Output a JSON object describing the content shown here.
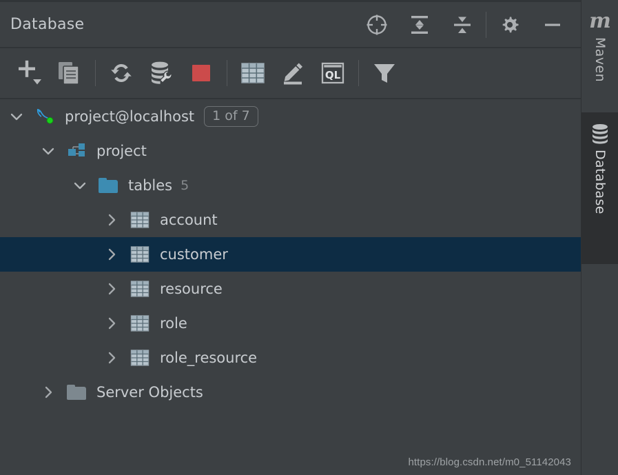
{
  "header": {
    "title": "Database",
    "actions": [
      {
        "name": "scroll-from-source-button",
        "icon": "crosshair-icon"
      },
      {
        "name": "expand-all-button",
        "icon": "expand-all-icon"
      },
      {
        "name": "collapse-all-button",
        "icon": "collapse-all-icon"
      },
      {
        "name": "settings-button",
        "icon": "gear-icon"
      },
      {
        "name": "hide-button",
        "icon": "minimize-icon"
      }
    ]
  },
  "toolbar": {
    "buttons": [
      {
        "name": "add-button",
        "icon": "plus-dropdown-icon"
      },
      {
        "name": "duplicate-button",
        "icon": "copy-icon"
      },
      {
        "name": "refresh-button",
        "icon": "refresh-icon"
      },
      {
        "name": "data-source-properties-button",
        "icon": "database-wrench-icon"
      },
      {
        "name": "stop-button",
        "icon": "stop-square-icon"
      },
      {
        "name": "jump-to-table-button",
        "icon": "table-grid-icon"
      },
      {
        "name": "edit-button",
        "icon": "pencil-icon"
      },
      {
        "name": "open-console-button",
        "icon": "ql-console-icon"
      },
      {
        "name": "filter-button",
        "icon": "funnel-icon"
      }
    ],
    "ql_label": "QL"
  },
  "tree": {
    "nodes": [
      {
        "label": "project@localhost",
        "icon": "mysql-dolphin-icon",
        "status": "connected",
        "badge": "1 of 7",
        "expanded": true,
        "selected": false,
        "indent": 0
      },
      {
        "label": "project",
        "icon": "schema-icon",
        "expanded": true,
        "selected": false,
        "indent": 1
      },
      {
        "label": "tables",
        "icon": "folder-teal-icon",
        "count": "5",
        "expanded": true,
        "selected": false,
        "indent": 2
      },
      {
        "label": "account",
        "icon": "table-icon",
        "expanded": false,
        "selected": false,
        "indent": 3
      },
      {
        "label": "customer",
        "icon": "table-icon",
        "expanded": false,
        "selected": true,
        "indent": 3
      },
      {
        "label": "resource",
        "icon": "table-icon",
        "expanded": false,
        "selected": false,
        "indent": 3
      },
      {
        "label": "role",
        "icon": "table-icon",
        "expanded": false,
        "selected": false,
        "indent": 3
      },
      {
        "label": "role_resource",
        "icon": "table-icon",
        "expanded": false,
        "selected": false,
        "indent": 3
      },
      {
        "label": "Server Objects",
        "icon": "folder-gray-icon",
        "expanded": false,
        "selected": false,
        "indent": 1
      }
    ]
  },
  "sidebar": {
    "items": [
      {
        "label": "Maven",
        "icon": "maven-m-icon",
        "active": false
      },
      {
        "label": "Database",
        "icon": "database-cylinder-icon",
        "active": true
      }
    ]
  },
  "watermark": "https://blog.csdn.net/m0_51142043",
  "colors": {
    "background": "#3c4043",
    "selection": "#0d2c44",
    "accent_teal": "#3d8cb2",
    "stop_red": "#cc4b4b",
    "connected_green": "#19d01b",
    "mysql_blue": "#2f9ee0",
    "text": "#c8ccd0"
  }
}
